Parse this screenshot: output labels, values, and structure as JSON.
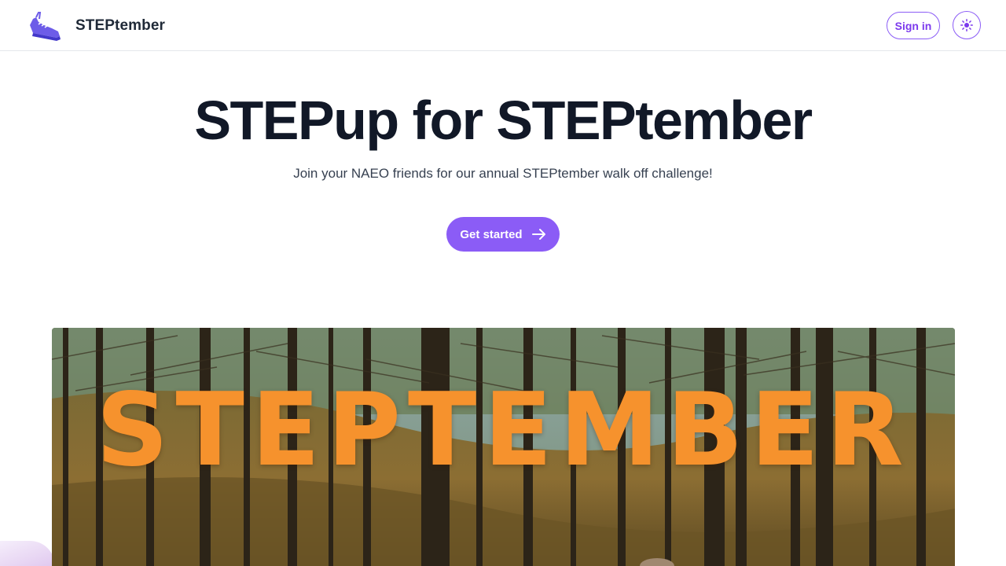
{
  "header": {
    "brand_name": "STEPtember",
    "brand_icon": "shoe-icon",
    "sign_in_label": "Sign in",
    "theme_icon": "sun-icon"
  },
  "hero": {
    "title": "STEPup for STEPtember",
    "subtitle": "Join your NAEO friends for our annual STEPtember walk off challenge!",
    "cta_label": "Get started",
    "cta_icon": "arrow-right-icon"
  },
  "banner": {
    "text": "STEPTEMBER",
    "text_color": "#f6922d"
  },
  "colors": {
    "accent": "#8b5cf6",
    "heading": "#111827",
    "body": "#374151"
  }
}
